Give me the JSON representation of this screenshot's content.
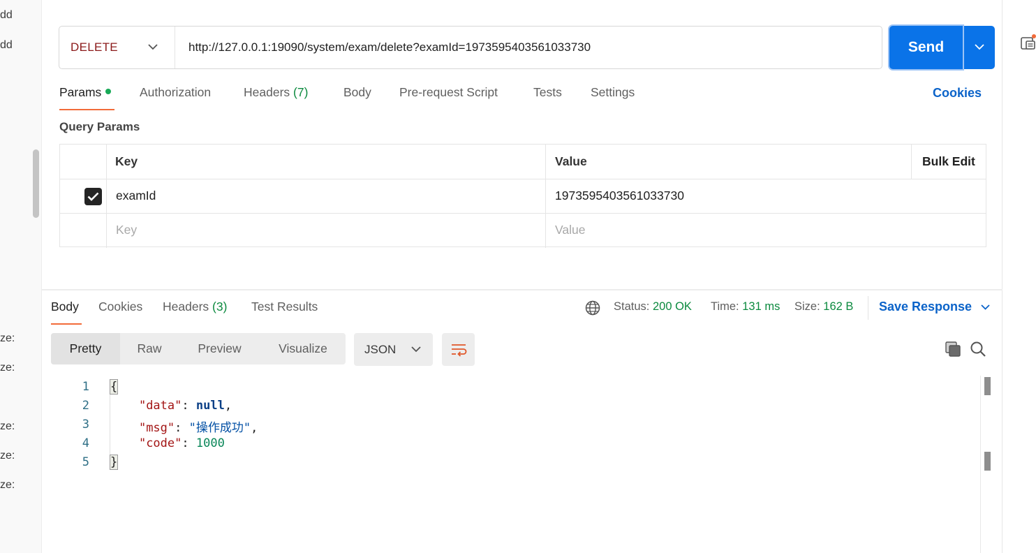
{
  "left_strip": {
    "fragments": [
      "dd",
      "dd",
      "ze:",
      "ze:",
      "ze:",
      "ze:",
      "ze:"
    ]
  },
  "request": {
    "method": "DELETE",
    "url": "http://127.0.0.1:19090/system/exam/delete?examId=1973595403561033730",
    "send_label": "Send"
  },
  "request_tabs": {
    "params": "Params",
    "authorization": "Authorization",
    "headers": "Headers",
    "headers_count": "(7)",
    "body": "Body",
    "prerequest": "Pre-request Script",
    "tests": "Tests",
    "settings": "Settings",
    "cookies": "Cookies"
  },
  "query_params": {
    "title": "Query Params",
    "col_key": "Key",
    "col_value": "Value",
    "bulk_edit": "Bulk Edit",
    "rows": [
      {
        "key": "examId",
        "value": "1973595403561033730",
        "checked": true
      }
    ],
    "key_placeholder": "Key",
    "value_placeholder": "Value"
  },
  "response_tabs": {
    "body": "Body",
    "cookies": "Cookies",
    "headers": "Headers",
    "headers_count": "(3)",
    "test_results": "Test Results"
  },
  "response_meta": {
    "status_label": "Status:",
    "status_value": "200 OK",
    "time_label": "Time:",
    "time_value": "131 ms",
    "size_label": "Size:",
    "size_value": "162 B",
    "save_response": "Save Response"
  },
  "view_modes": {
    "pretty": "Pretty",
    "raw": "Raw",
    "preview": "Preview",
    "visualize": "Visualize",
    "format": "JSON"
  },
  "response_body": {
    "line_numbers": [
      "1",
      "2",
      "3",
      "4",
      "5"
    ],
    "open_brace": "{",
    "close_brace": "}",
    "data_key": "\"data\"",
    "data_value": "null",
    "msg_key": "\"msg\"",
    "msg_value": "\"操作成功\"",
    "code_key": "\"code\"",
    "code_value": "1000"
  },
  "colors": {
    "accent": "#0a73e8",
    "method": "#8b1a1a",
    "success": "#0c8a3f",
    "tab_indicator": "#f26b3a",
    "link": "#0b63c9"
  }
}
